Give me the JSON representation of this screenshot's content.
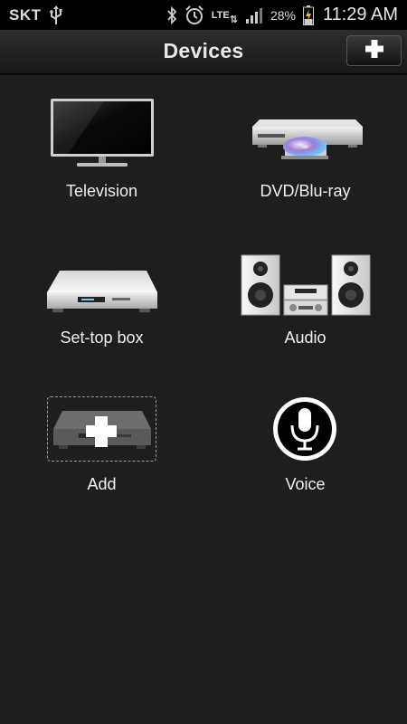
{
  "status_bar": {
    "carrier": "SKT",
    "network": "LTE",
    "battery": "28%",
    "time": "11:29 AM",
    "icons": [
      "usb-icon",
      "bluetooth-icon",
      "alarm-icon",
      "lte-icon",
      "signal-icon",
      "battery-charging-icon"
    ]
  },
  "header": {
    "title": "Devices",
    "add_icon": "plus-icon"
  },
  "devices": [
    {
      "label": "Television",
      "icon": "television-icon"
    },
    {
      "label": "DVD/Blu-ray",
      "icon": "dvd-player-icon"
    },
    {
      "label": "Set-top box",
      "icon": "set-top-box-icon"
    },
    {
      "label": "Audio",
      "icon": "audio-system-icon"
    },
    {
      "label": "Add",
      "icon": "add-device-icon"
    },
    {
      "label": "Voice",
      "icon": "microphone-icon"
    }
  ],
  "colors": {
    "background": "#1e1e1e",
    "status_bar": "#000000",
    "text": "#f0f0f0"
  }
}
